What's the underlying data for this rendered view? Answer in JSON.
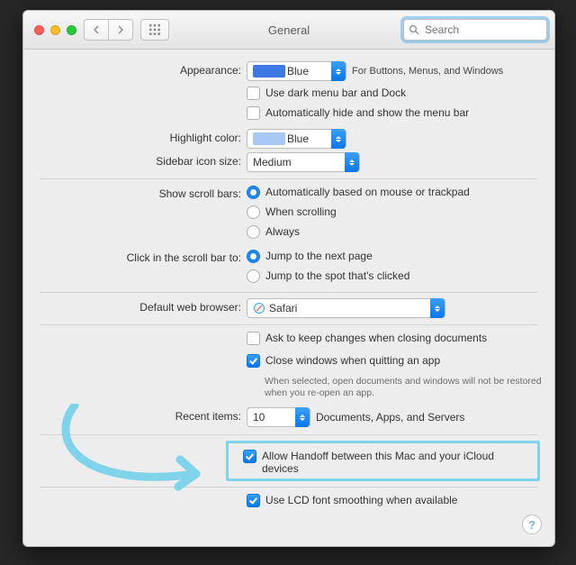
{
  "colors": {
    "accent_blue": "#1984f2",
    "highlight_swatch": "#a6c8f2",
    "appearance_swatch": "#3d79e5",
    "annotation": "#7fd3ea"
  },
  "title": "General",
  "search_placeholder": "Search",
  "rows": {
    "appearance": {
      "label": "Appearance:",
      "value": "Blue",
      "note": "For Buttons, Menus, and Windows",
      "dark_mode": "Use dark menu bar and Dock",
      "auto_hide": "Automatically hide and show the menu bar"
    },
    "highlight": {
      "label": "Highlight color:",
      "value": "Blue"
    },
    "sidebar": {
      "label": "Sidebar icon size:",
      "value": "Medium"
    },
    "scrollbars": {
      "label": "Show scroll bars:",
      "opt1": "Automatically based on mouse or trackpad",
      "opt2": "When scrolling",
      "opt3": "Always"
    },
    "click_scroll": {
      "label": "Click in the scroll bar to:",
      "opt1": "Jump to the next page",
      "opt2": "Jump to the spot that's clicked"
    },
    "browser": {
      "label": "Default web browser:",
      "value": "Safari"
    },
    "documents": {
      "ask": "Ask to keep changes when closing documents",
      "close_windows": "Close windows when quitting an app",
      "hint": "When selected, open documents and windows will not be restored when you re-open an app."
    },
    "recent": {
      "label": "Recent items:",
      "value": "10",
      "note": "Documents, Apps, and Servers"
    },
    "handoff": "Allow Handoff between this Mac and your iCloud devices",
    "lcd": "Use LCD font smoothing when available"
  }
}
